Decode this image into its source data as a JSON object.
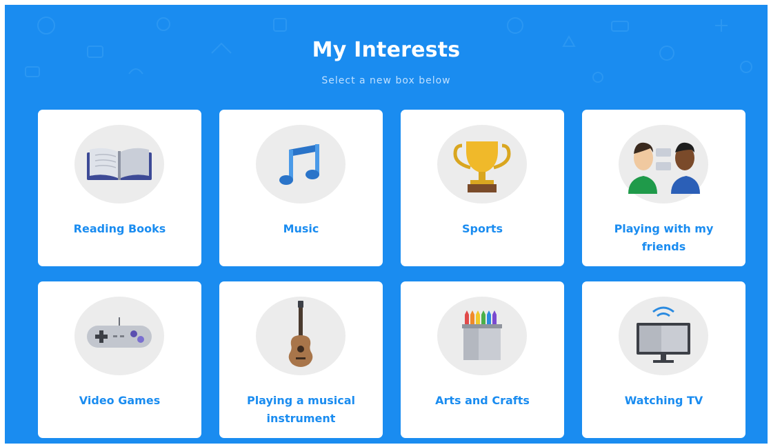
{
  "header": {
    "title": "My Interests",
    "subtitle": "Select a new box below"
  },
  "interests": [
    {
      "label": "Reading Books",
      "icon": "book-icon"
    },
    {
      "label": "Music",
      "icon": "music-note-icon"
    },
    {
      "label": "Sports",
      "icon": "trophy-icon"
    },
    {
      "label": "Playing with my friends",
      "icon": "friends-icon"
    },
    {
      "label": "Video Games",
      "icon": "gamepad-icon"
    },
    {
      "label": "Playing a musical instrument",
      "icon": "guitar-icon"
    },
    {
      "label": "Arts and Crafts",
      "icon": "crayons-icon"
    },
    {
      "label": "Watching TV",
      "icon": "tv-icon"
    }
  ],
  "colors": {
    "background": "#1a8cf0",
    "card": "#ffffff",
    "label": "#1a8cf0",
    "icon_circle": "#ececec"
  }
}
